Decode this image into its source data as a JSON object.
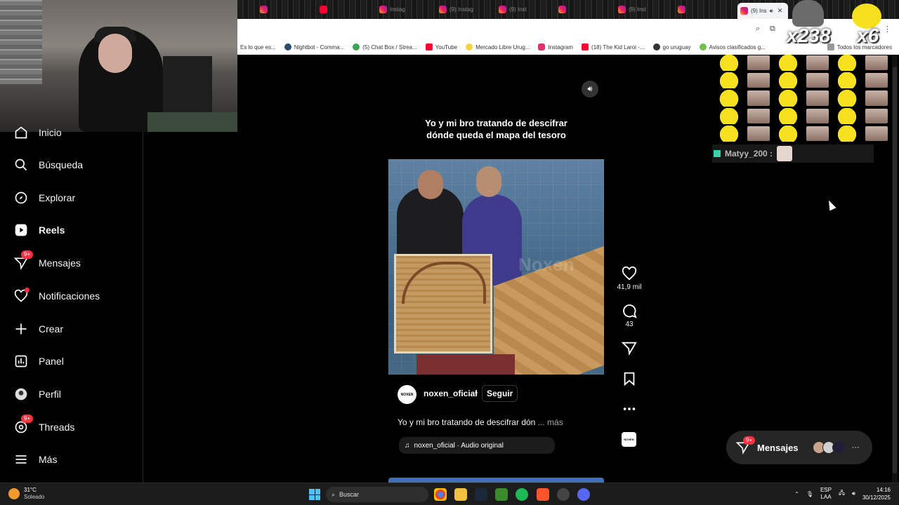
{
  "browser": {
    "tabs": [
      {
        "label": "",
        "icon": "instagram-icon"
      },
      {
        "label": "",
        "icon": "youtube-icon"
      },
      {
        "label": "Instag",
        "icon": "instagram-icon"
      },
      {
        "label": "(9) Instag",
        "icon": "instagram-icon"
      },
      {
        "label": "(9) Inst",
        "icon": "instagram-icon"
      },
      {
        "label": "",
        "icon": "instagram-icon"
      },
      {
        "label": "(9) Inst",
        "icon": "instagram-icon"
      },
      {
        "label": "",
        "icon": "instagram-icon"
      }
    ],
    "active_tab": {
      "label": "(9) Ins"
    },
    "bookmarks": [
      {
        "label": "Es lo que es...",
        "color": "#888888"
      },
      {
        "label": "Nightbot - Comma...",
        "color": "#2b4b6b"
      },
      {
        "label": "(5) Chat Box / Strea...",
        "color": "#3aa655"
      },
      {
        "label": "YouTube",
        "color": "#ff0033"
      },
      {
        "label": "Mercado Libre Urug...",
        "color": "#f5d442"
      },
      {
        "label": "Instagram",
        "color": "#e1306c"
      },
      {
        "label": "(18) The Kid Laroi -...",
        "color": "#ff0033"
      },
      {
        "label": "go uruguay",
        "color": "#333333"
      },
      {
        "label": "Avisos clasificados g...",
        "color": "#6fbf4a"
      }
    ],
    "all_bookmarks": "Todos los marcadores"
  },
  "sidebar": {
    "items": [
      {
        "label": "Inicio",
        "icon": "home-icon"
      },
      {
        "label": "Búsqueda",
        "icon": "search-icon"
      },
      {
        "label": "Explorar",
        "icon": "compass-icon"
      },
      {
        "label": "Reels",
        "icon": "reels-icon"
      },
      {
        "label": "Mensajes",
        "icon": "messenger-icon",
        "badge": "9+"
      },
      {
        "label": "Notificaciones",
        "icon": "heart-icon"
      },
      {
        "label": "Crear",
        "icon": "plus-icon"
      },
      {
        "label": "Panel",
        "icon": "chart-icon"
      },
      {
        "label": "Perfil",
        "icon": "profile-icon"
      },
      {
        "label": "Threads",
        "icon": "threads-icon",
        "badge": "9+"
      },
      {
        "label": "Más",
        "icon": "menu-icon"
      }
    ]
  },
  "reel": {
    "top_caption": "Yo y mi bro tratando de descifrar dónde queda el mapa del tesoro",
    "watermark": "Noxen",
    "username": "noxen_oficial",
    "separator": "•",
    "follow_label": "Seguir",
    "caption": "Yo y mi bro tratando de descifrar dón",
    "more_label": "... más",
    "audio_label": "noxen_oficial · Audio original",
    "avatar_text": "NOXEN"
  },
  "actions": {
    "likes": "41,9 mil",
    "comments": "43"
  },
  "overlay": {
    "counter_a": "x238",
    "counter_b": "x6",
    "chat_user": "Matyy_200 :"
  },
  "messages_pill": {
    "label": "Mensajes",
    "badge": "9+",
    "more": "···"
  },
  "taskbar": {
    "temp": "31°C",
    "condition": "Soleado",
    "search_placeholder": "Buscar",
    "lang1": "ESP",
    "lang2": "LAA",
    "time": "14:16",
    "date": "30/12/2025"
  },
  "colors": {
    "accent_red": "#ff3040",
    "background": "#000000",
    "win_blue": "#4cc2ff"
  }
}
